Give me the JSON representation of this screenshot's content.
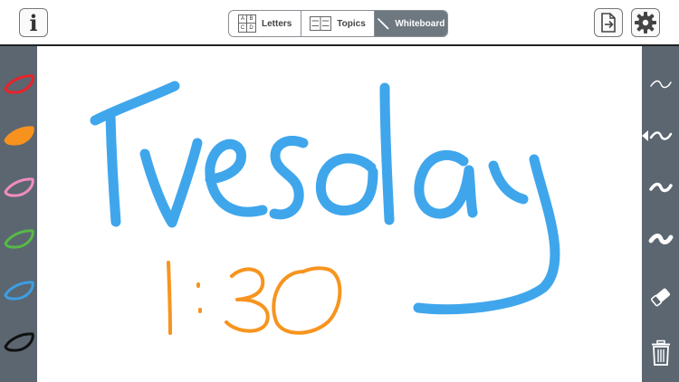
{
  "toolbar": {
    "info_button": "i",
    "tabs": [
      {
        "label": "Letters",
        "active": false
      },
      {
        "label": "Topics",
        "active": false
      },
      {
        "label": "Whiteboard",
        "active": true
      }
    ],
    "letters_icon_glyphs": [
      "A",
      "B",
      "C",
      "D"
    ]
  },
  "palette": {
    "colors": [
      "#e8232b",
      "#f7921e",
      "#f08cc0",
      "#57b947",
      "#3d9ee3",
      "#111111"
    ],
    "selected_index": 1
  },
  "strokes": {
    "widths": [
      "thin",
      "medium",
      "thick",
      "extra-thick"
    ],
    "selected_index": 1
  },
  "whiteboard": {
    "ink_colors": {
      "blue": "#3fa6ec",
      "orange": "#f7941e"
    }
  },
  "colors": {
    "sidebar": "#5b6670",
    "active_tab": "#6e7881"
  }
}
